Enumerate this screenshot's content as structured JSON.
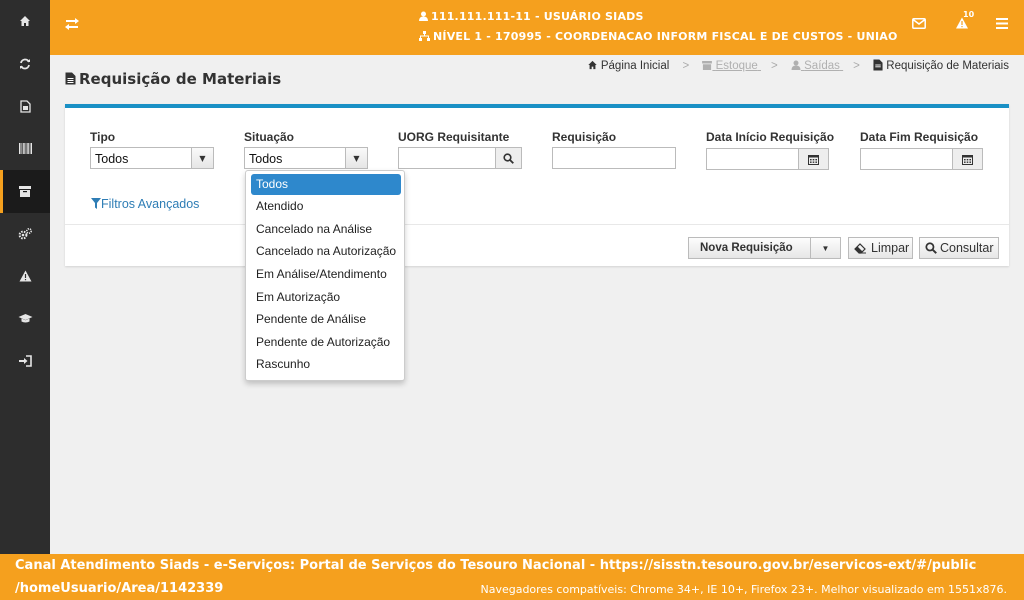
{
  "topbar": {
    "user": "111.111.111-11 - USUÁRIO SIADS",
    "level": "NÍVEL 1 - 170995 - COORDENACAO INFORM FISCAL E DE CUSTOS - UNIAO",
    "alert_count": "10"
  },
  "page": {
    "title": "Requisição de Materiais"
  },
  "breadcrumb": {
    "home": "Página Inicial",
    "estoque": "Estoque",
    "saidas": "Saídas",
    "current": "Requisição de Materiais",
    "separator": ">"
  },
  "form": {
    "tipo_label": "Tipo",
    "tipo_value": "Todos",
    "situacao_label": "Situação",
    "situacao_value": "Todos",
    "uorg_label": "UORG Requisitante",
    "uorg_value": "",
    "requisicao_label": "Requisição",
    "requisicao_value": "",
    "data_inicio_label": "Data Início Requisição",
    "data_inicio_value": "",
    "data_fim_label": "Data Fim Requisição",
    "data_fim_value": "",
    "advanced_filters": "Filtros Avançados"
  },
  "buttons": {
    "nova_requisicao": "Nova Requisição",
    "limpar": "Limpar",
    "consultar": "Consultar"
  },
  "situacao_options": [
    "Todos",
    "Atendido",
    "Cancelado na Análise",
    "Cancelado na Autorização",
    "Em Análise/Atendimento",
    "Em Autorização",
    "Pendente de Análise",
    "Pendente de Autorização",
    "Rascunho"
  ],
  "situacao_selected": "Todos",
  "footer": {
    "line1": "Canal Atendimento Siads - e-Serviços: Portal de Serviços do Tesouro Nacional - https://sisstn.tesouro.gov.br/eservicos-ext/#/public",
    "line2": "/homeUsuario/Area/1142339",
    "browsers": "Navegadores compatíveis: Chrome 34+, IE 10+, Firefox 23+. Melhor visualizado em 1551x876."
  },
  "sidebar": {
    "icons": [
      "home-icon",
      "refresh-icon",
      "document-icon",
      "barcode-icon",
      "archive-icon",
      "gears-icon",
      "warning-icon",
      "graduation-cap-icon",
      "sign-in-icon"
    ],
    "active": "archive-icon"
  },
  "colors": {
    "brand_orange": "#f5a01e",
    "sidebar": "#2d2d2d",
    "accent_blue": "#1a90c5",
    "selected_blue": "#2e88cc"
  }
}
